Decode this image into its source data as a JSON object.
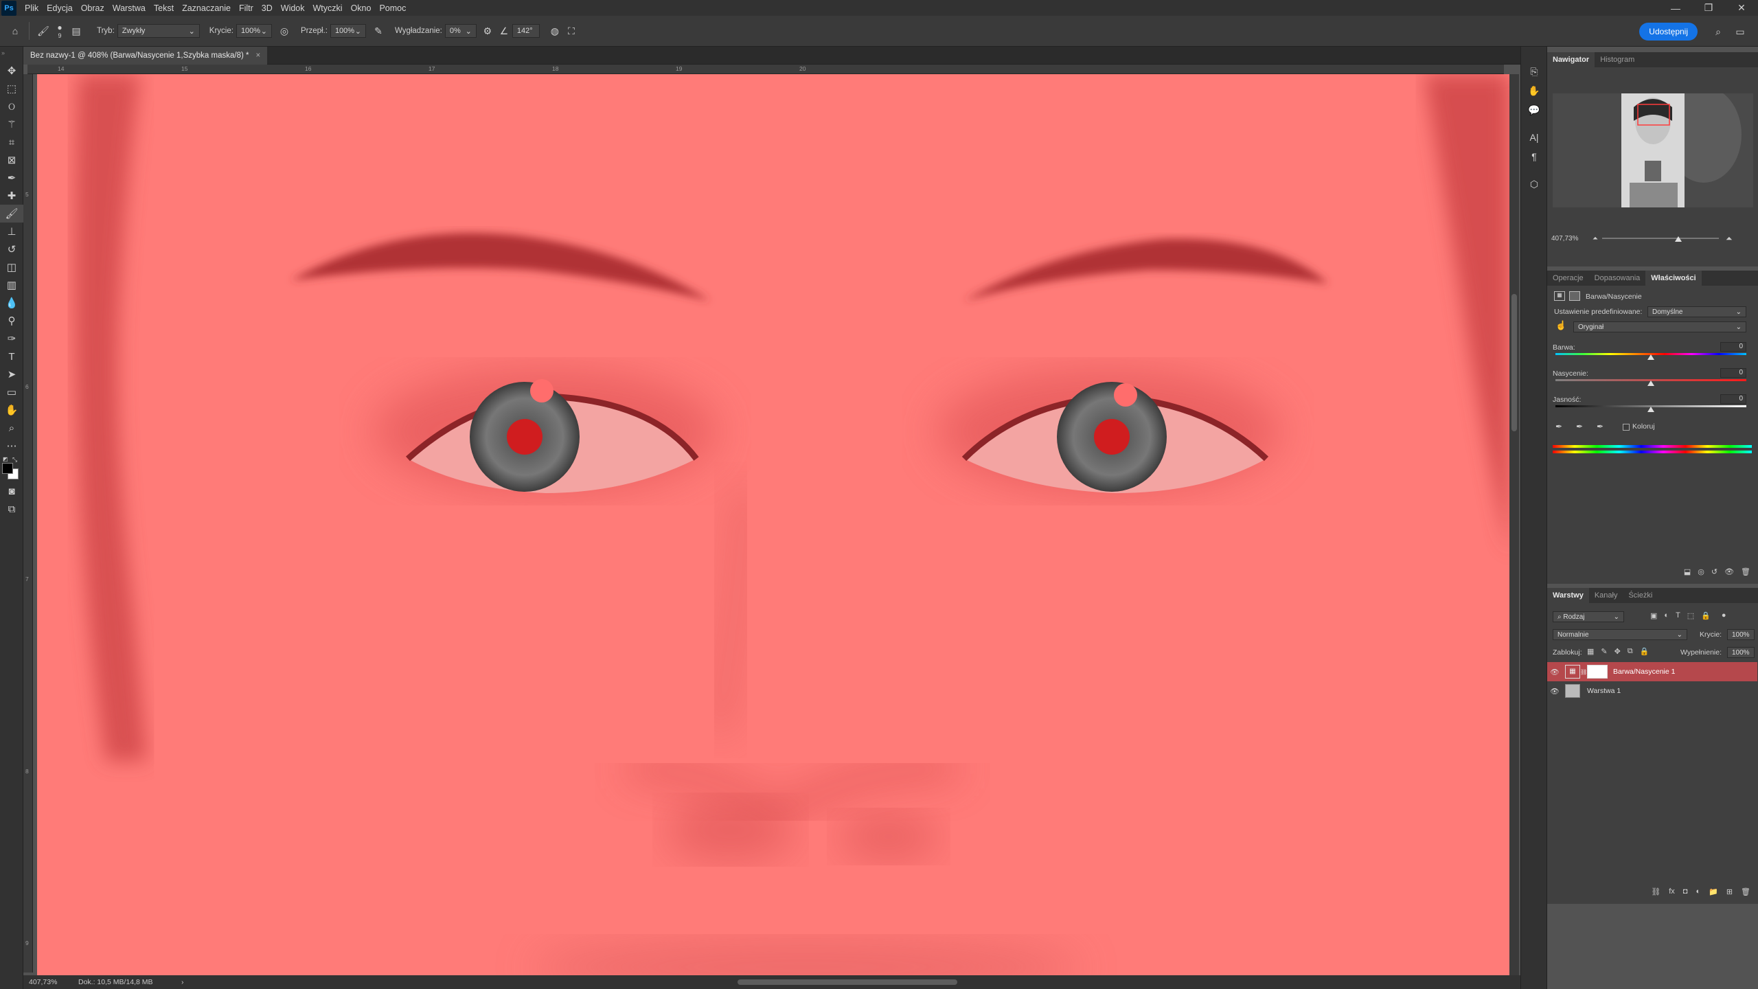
{
  "menu": {
    "logo": "Ps",
    "items": [
      "Plik",
      "Edycja",
      "Obraz",
      "Warstwa",
      "Tekst",
      "Zaznaczanie",
      "Filtr",
      "3D",
      "Widok",
      "Wtyczki",
      "Okno",
      "Pomoc"
    ]
  },
  "options": {
    "brush_size": "9",
    "mode_label": "Tryb:",
    "mode_value": "Zwykły",
    "opacity_label": "Krycie:",
    "opacity_value": "100%",
    "flow_label": "Przepł.:",
    "flow_value": "100%",
    "smoothing_label": "Wygładzanie:",
    "smoothing_value": "0%",
    "angle_value": "142°",
    "share_label": "Udostępnij"
  },
  "document": {
    "tab_title": "Bez nazwy-1 @ 408% (Barwa/Nasycenie 1,Szybka maska/8) *",
    "close": "×",
    "ruler_top": [
      "14",
      "15",
      "16",
      "17",
      "18",
      "19",
      "20"
    ],
    "ruler_left": [
      "5",
      "6",
      "7",
      "8",
      "9"
    ]
  },
  "status": {
    "zoom": "407,73%",
    "doc": "Dok.: 10,5 MB/14,8 MB",
    "arrow": "›"
  },
  "navigator": {
    "tabs": [
      "Nawigator",
      "Histogram"
    ],
    "zoom": "407,73%"
  },
  "properties": {
    "tabs": [
      "Operacje",
      "Dopasowania",
      "Właściwości"
    ],
    "title": "Barwa/Nasycenie",
    "preset_label": "Ustawienie predefiniowane:",
    "preset_value": "Domyślne",
    "channel_value": "Oryginał",
    "hue_label": "Barwa:",
    "hue_value": "0",
    "sat_label": "Nasycenie:",
    "sat_value": "0",
    "light_label": "Jasność:",
    "light_value": "0",
    "colorize_label": "Koloruj"
  },
  "layers": {
    "tabs": [
      "Warstwy",
      "Kanały",
      "Ścieżki"
    ],
    "filter_label": "Rodzaj",
    "blend_mode": "Normalnie",
    "opacity_label": "Krycie:",
    "opacity_value": "100%",
    "lock_label": "Zablokuj:",
    "fill_label": "Wypełnienie:",
    "fill_value": "100%",
    "items": [
      {
        "name": "Barwa/Nasycenie 1"
      },
      {
        "name": "Warstwa 1"
      }
    ]
  },
  "colors": {
    "quick_mask": "#ff7b78",
    "selected_layer": "#b5484c",
    "accent": "#1473e6"
  }
}
